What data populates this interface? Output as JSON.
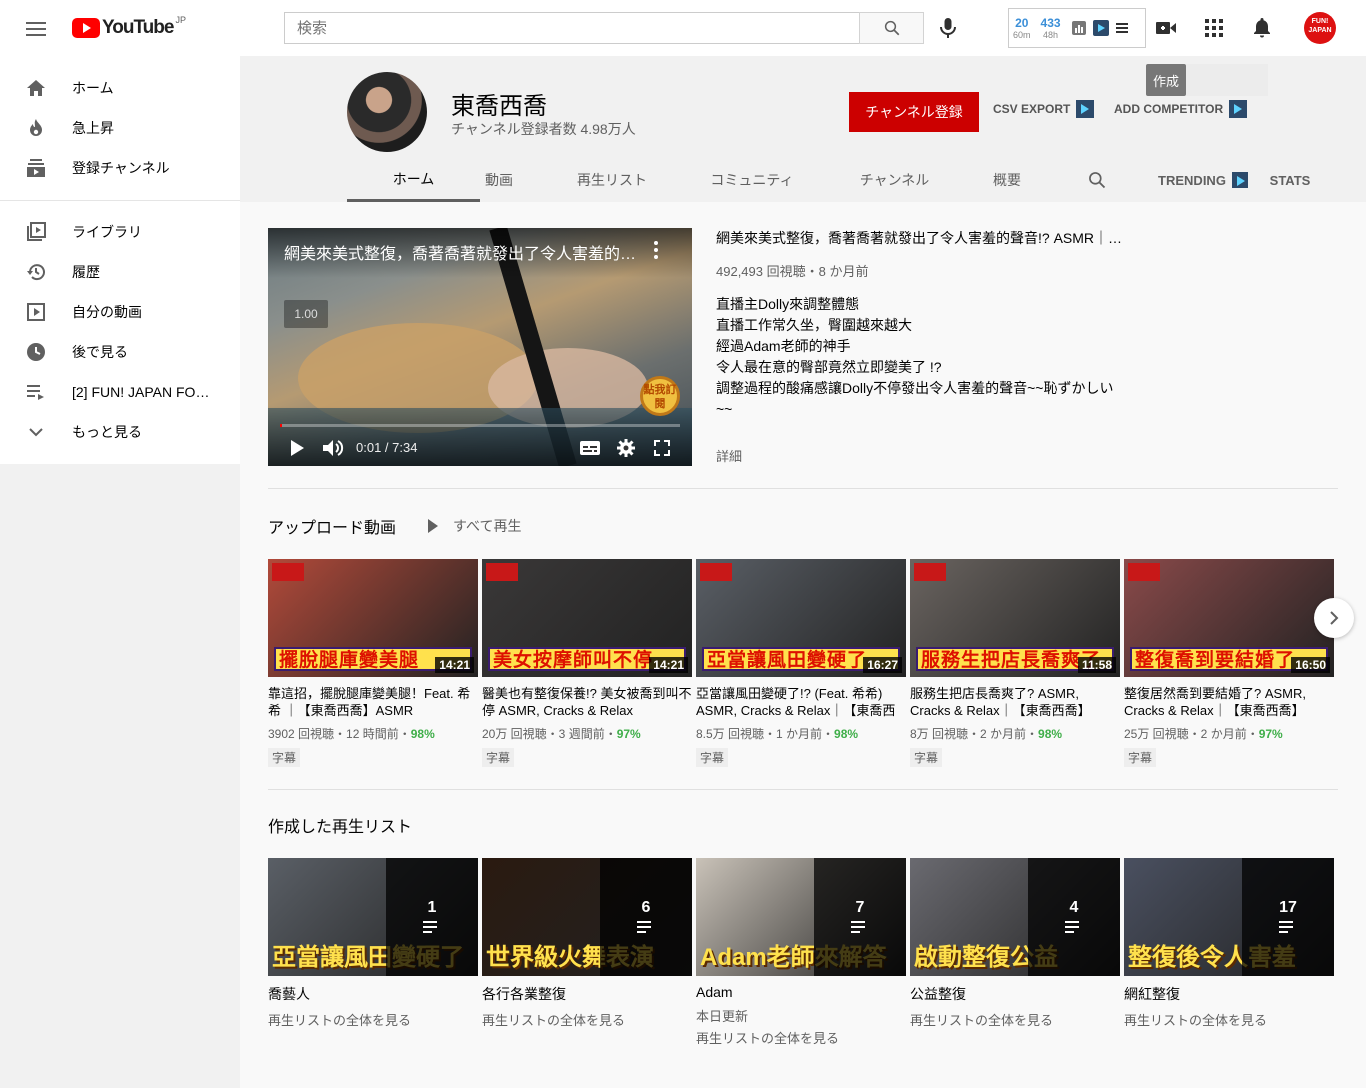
{
  "header": {
    "logo_text": "YouTube",
    "logo_region": "JP",
    "search_placeholder": "検索",
    "ext": {
      "stat1_value": "20",
      "stat1_label": "60m",
      "stat2_value": "433",
      "stat2_label": "48h"
    },
    "avatar_text": "FUN! JAPAN"
  },
  "sidebar": {
    "items": [
      {
        "label": "ホーム",
        "icon": "home-icon"
      },
      {
        "label": "急上昇",
        "icon": "fire-icon"
      },
      {
        "label": "登録チャンネル",
        "icon": "subscriptions-icon"
      },
      {
        "label": "ライブラリ",
        "icon": "library-icon"
      },
      {
        "label": "履歴",
        "icon": "history-icon"
      },
      {
        "label": "自分の動画",
        "icon": "my-videos-icon"
      },
      {
        "label": "後で見る",
        "icon": "watch-later-icon"
      },
      {
        "label": "[2] FUN! JAPAN FOO...",
        "icon": "playlist-icon"
      },
      {
        "label": "もっと見る",
        "icon": "chevron-down-icon"
      }
    ]
  },
  "channel": {
    "name": "東喬西喬",
    "subscribers": "チャンネル登録者数 4.98万人",
    "subscribe_label": "チャンネル登録",
    "csv_export": "CSV EXPORT",
    "add_competitor": "ADD COMPETITOR",
    "tooltip": "作成",
    "tabs": [
      "ホーム",
      "動画",
      "再生リスト",
      "コミュニティ",
      "チャンネル",
      "概要"
    ],
    "tab_trending": "TRENDING",
    "tab_stats": "STATS"
  },
  "featured": {
    "player_title": "網美來美式整復，喬著喬著就發出了令人害羞的聲音!? ASMR",
    "speed": "1.00",
    "badge": "點我訂閱",
    "time": "0:01 / 7:34",
    "progress": 0.002,
    "title": "網美來美式整復，喬著喬著就發出了令人害羞的聲音!? ASMR｜【東喬西喬】",
    "meta": "492,493 回視聴・8 か月前",
    "desc": [
      "直播主Dolly來調整體態",
      "直播工作常久坐，臀圍越來越大",
      "經過Adam老師的神手",
      "令人最在意的臀部竟然立即變美了 !?",
      "調整過程的酸痛感讓Dolly不停發出令人害羞的聲音~~恥ずかしい",
      "~~"
    ],
    "more": "詳細"
  },
  "uploads": {
    "title": "アップロード動画",
    "play_all": "すべて再生",
    "videos": [
      {
        "cap": "擺脫腿庫變美腿",
        "dur": "14:21",
        "title": "靠這招，擺脫腿庫變美腿！Feat. 希希 ｜【東喬西喬】ASMR",
        "views": "3902 回視聴・12 時間前・",
        "pct": "98%",
        "cc": "字幕",
        "bg": "#b24a3a"
      },
      {
        "cap": "美女按摩師叫不停",
        "dur": "14:21",
        "title": "醫美也有整復保養!? 美女被喬到叫不停 ASMR, Cracks & Relax",
        "views": "20万 回視聴・3 週間前・",
        "pct": "97%",
        "cc": "字幕",
        "bg": "#3a3838"
      },
      {
        "cap": "亞當讓風田變硬了",
        "dur": "16:27",
        "title": "亞當讓風田變硬了!? (Feat. 希希) ASMR, Cracks & Relax｜【東喬西喬】",
        "views": "8.5万 回視聴・1 か月前・",
        "pct": "98%",
        "cc": "字幕",
        "bg": "#5a5f66"
      },
      {
        "cap": "服務生把店長喬爽了",
        "dur": "11:58",
        "title": "服務生把店長喬爽了? ASMR, Cracks & Relax｜【東喬西喬】",
        "views": "8万 回視聴・2 か月前・",
        "pct": "98%",
        "cc": "字幕",
        "bg": "#6a6460"
      },
      {
        "cap": "整復喬到要結婚了",
        "dur": "16:50",
        "title": "整復居然喬到要結婚了? ASMR, Cracks & Relax｜【東喬西喬】",
        "views": "25万 回視聴・2 か月前・",
        "pct": "97%",
        "cc": "字幕",
        "bg": "#8a4a4a"
      }
    ]
  },
  "playlists": {
    "title": "作成した再生リスト",
    "items": [
      {
        "cap": "亞當讓風田變硬了",
        "count": "1",
        "title": "喬藝人",
        "sub": [
          "再生リストの全体を見る"
        ],
        "bg": "#5a5f66"
      },
      {
        "cap": "世界級火舞表演",
        "count": "6",
        "title": "各行各業整復",
        "sub": [
          "再生リストの全体を見る"
        ],
        "bg": "#2a1a10"
      },
      {
        "cap": "Adam老師來解答",
        "count": "7",
        "title": "Adam",
        "sub": [
          "本日更新",
          "再生リストの全体を見る"
        ],
        "bg": "#c9c2b8"
      },
      {
        "cap": "啟動整復公益",
        "count": "4",
        "title": "公益整復",
        "sub": [
          "再生リストの全体を見る"
        ],
        "bg": "#6a6a70"
      },
      {
        "cap": "整復後令人害羞",
        "count": "17",
        "title": "網紅整復",
        "sub": [
          "再生リストの全体を見る"
        ],
        "bg": "#4a5060"
      }
    ]
  }
}
